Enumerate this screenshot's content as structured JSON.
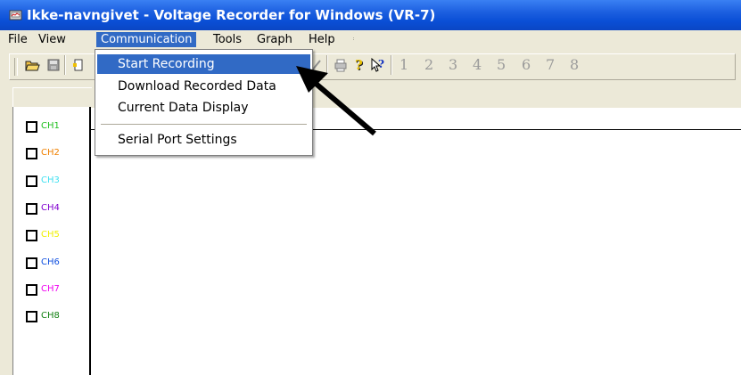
{
  "window": {
    "title": "Ikke-navngivet - Voltage Recorder for Windows (VR-7)"
  },
  "menubar": {
    "items": [
      {
        "label": "File"
      },
      {
        "label": "View"
      },
      {
        "label": "Communication"
      },
      {
        "label": "Tools"
      },
      {
        "label": "Graph"
      },
      {
        "label": "Help"
      }
    ]
  },
  "toolbar": {
    "channel_numbers": [
      "1",
      "2",
      "3",
      "4",
      "5",
      "6",
      "7",
      "8"
    ]
  },
  "dropdown": {
    "items": [
      {
        "label": "Start Recording"
      },
      {
        "label": "Download Recorded Data"
      },
      {
        "label": "Current Data Display"
      },
      {
        "label": "Serial Port Settings"
      }
    ]
  },
  "channels": [
    {
      "label": "CH1",
      "color": "#1fbf1f"
    },
    {
      "label": "CH2",
      "color": "#f08000"
    },
    {
      "label": "CH3",
      "color": "#40e0f0"
    },
    {
      "label": "CH4",
      "color": "#8000d0"
    },
    {
      "label": "CH5",
      "color": "#f0f000"
    },
    {
      "label": "CH6",
      "color": "#1050e0"
    },
    {
      "label": "CH7",
      "color": "#f000f0"
    },
    {
      "label": "CH8",
      "color": "#108010"
    }
  ],
  "colors": {
    "titlebar": "#0a4fd6",
    "menu_highlight": "#316ac5",
    "chrome": "#ece9d8"
  }
}
